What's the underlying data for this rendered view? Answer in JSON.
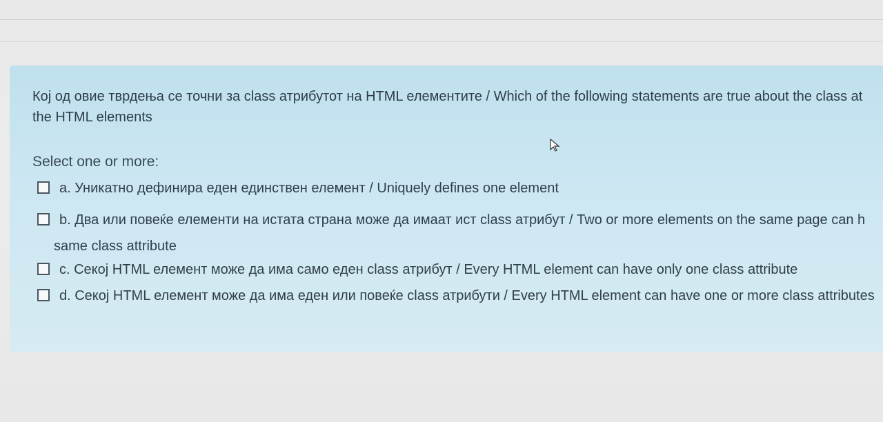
{
  "question": {
    "text_line1": "Кој од овие тврдења се точни за class атрибутот на HTML елементите / Which of the following statements are true about the class at",
    "text_line2": "the HTML elements",
    "prompt": "Select one or more:"
  },
  "answers": [
    {
      "label": "a. Уникатно дефинира еден единствен елемент / Uniquely defines one element",
      "checked": false
    },
    {
      "label": "b. Два или повеќе елементи на истата страна може да имаат ист class атрибут / Two or more elements on the same page can h",
      "label_cont": "same class attribute",
      "checked": false
    },
    {
      "label": "c. Секој HTML елемент може да има само еден class атрибут / Every HTML element can have only one class attribute",
      "checked": false
    },
    {
      "label": "d. Секој HTML елемент може да има еден или повеќе class атрибути / Every HTML element can have one or more class attributes",
      "checked": false
    }
  ],
  "colors": {
    "panel": "#cde7f2",
    "text": "#2e3d4a",
    "background": "#ececec"
  },
  "icons": {
    "cursor": "mouse-pointer-icon"
  }
}
